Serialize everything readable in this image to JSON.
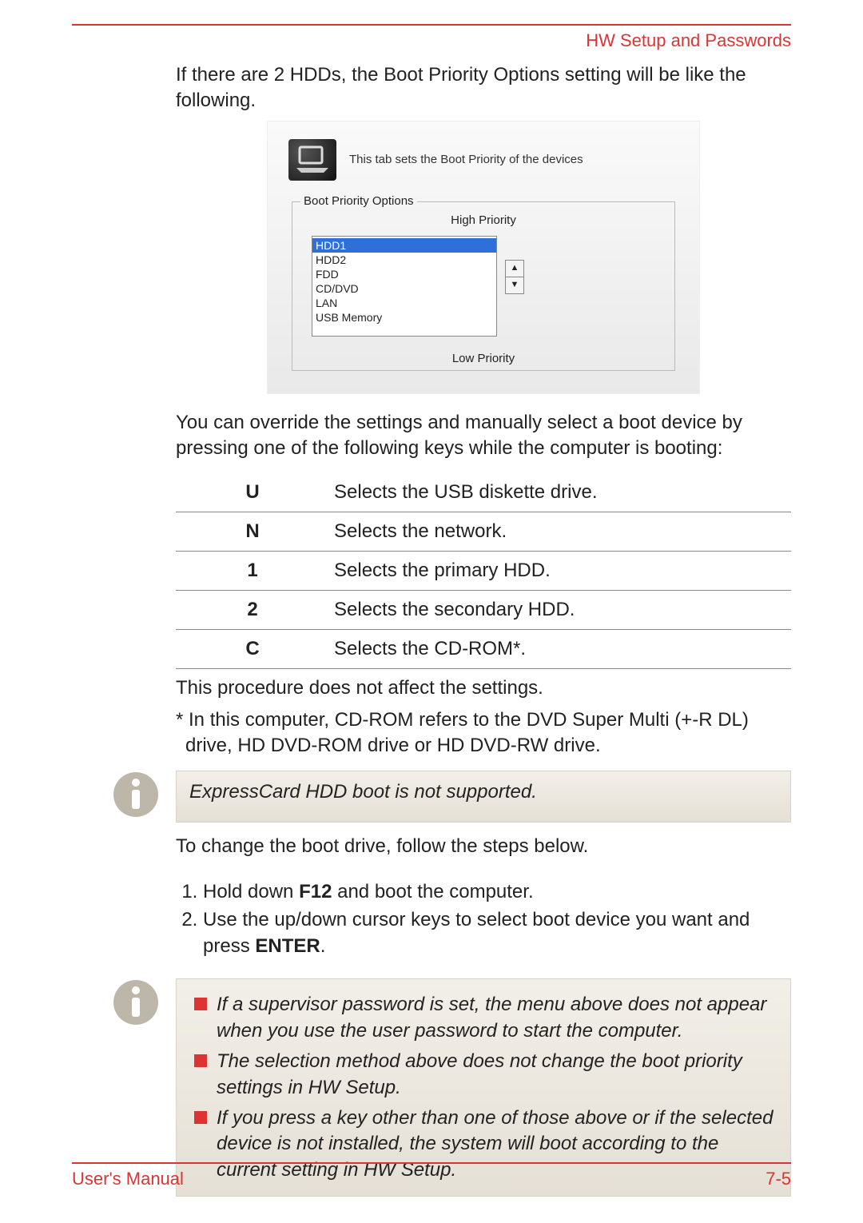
{
  "header": {
    "section": "HW Setup and Passwords"
  },
  "intro": "If there are 2 HDDs, the Boot Priority Options setting will be like the following.",
  "figure": {
    "caption": "This tab sets the Boot Priority of the devices",
    "group_label": "Boot Priority Options",
    "high": "High Priority",
    "low": "Low Priority",
    "items": [
      "HDD1",
      "HDD2",
      "FDD",
      "CD/DVD",
      "LAN",
      "USB Memory"
    ],
    "selected_index": 0
  },
  "override_text": "You can override the settings and manually select a boot device by pressing one of the following keys while the computer is booting:",
  "key_table": [
    {
      "key": "U",
      "desc": "Selects the USB diskette drive."
    },
    {
      "key": "N",
      "desc": "Selects the network."
    },
    {
      "key": "1",
      "desc": "Selects the primary HDD."
    },
    {
      "key": "2",
      "desc": "Selects the secondary HDD."
    },
    {
      "key": "C",
      "desc": "Selects the CD-ROM*."
    }
  ],
  "after_table_1": "This procedure does not affect the settings.",
  "after_table_2": "* In this computer, CD-ROM refers to the DVD Super Multi (+-R DL) drive, HD DVD-ROM drive or HD DVD-RW drive.",
  "note1": "ExpressCard HDD boot is not supported.",
  "change_intro": "To change the boot drive, follow the steps below.",
  "steps": {
    "s1a": "Hold down ",
    "s1b": "F12",
    "s1c": " and boot the computer.",
    "s2a": "Use the up/down cursor keys to select boot device you want and press ",
    "s2b": "ENTER",
    "s2c": "."
  },
  "note2": [
    "If a supervisor password is set, the menu above does not appear when you use the user password to start the computer.",
    "The selection method above does not change the boot priority settings in HW Setup.",
    "If you press a key other than one of those above or if the selected device is not installed, the system will boot according to the current setting in HW Setup."
  ],
  "footer": {
    "left": "User's Manual",
    "right": "7-5"
  }
}
